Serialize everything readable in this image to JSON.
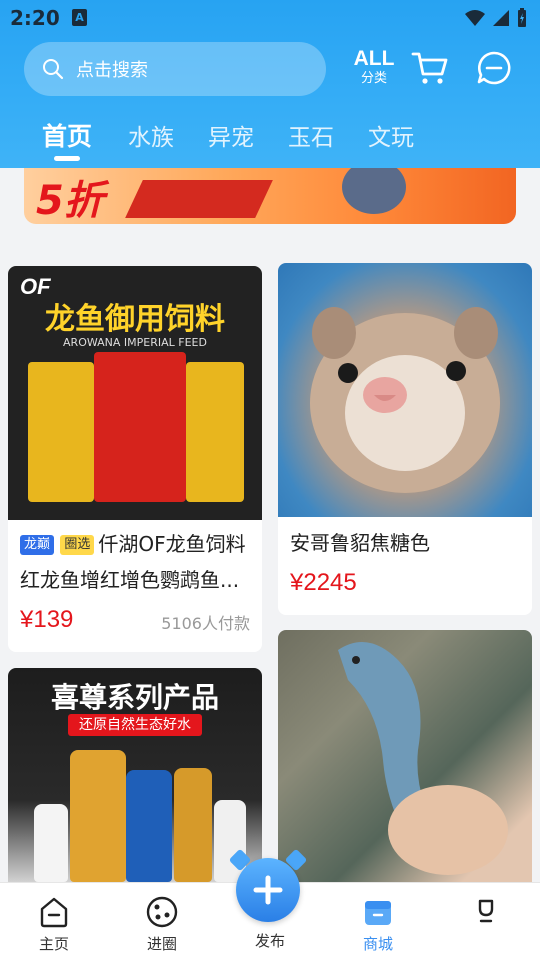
{
  "status": {
    "time": "2:20",
    "indicator": "A"
  },
  "search": {
    "placeholder": "点击搜索"
  },
  "category": {
    "big": "ALL",
    "small": "分类"
  },
  "tabs": [
    {
      "label": "首页",
      "active": true
    },
    {
      "label": "水族"
    },
    {
      "label": "异宠"
    },
    {
      "label": "玉石"
    },
    {
      "label": "文玩"
    }
  ],
  "banner": {
    "text": "5折"
  },
  "products": [
    {
      "image": {
        "brand": "OF",
        "headline": "龙鱼御用饲料",
        "sub": "AROWANA IMPERIAL FEED"
      },
      "tags": [
        "龙巅",
        "圈选"
      ],
      "title_line1": "仟湖OF龙鱼饲料",
      "title_line2": "红龙鱼增红增色鹦鹉鱼...",
      "price": "¥139",
      "sales": "5106人付款"
    },
    {
      "title": "安哥鲁貂焦糖色",
      "price": "¥2245"
    },
    {
      "image": {
        "headline": "喜尊系列产品",
        "sub": "还原自然生态好水"
      }
    },
    {}
  ],
  "nav": {
    "home": "主页",
    "circle": "进圈",
    "publish": "发布",
    "mall": "商城",
    "me": ""
  },
  "colors": {
    "header": "#27a3f2",
    "price": "#e4161c",
    "active_nav": "#3a8ff0"
  }
}
